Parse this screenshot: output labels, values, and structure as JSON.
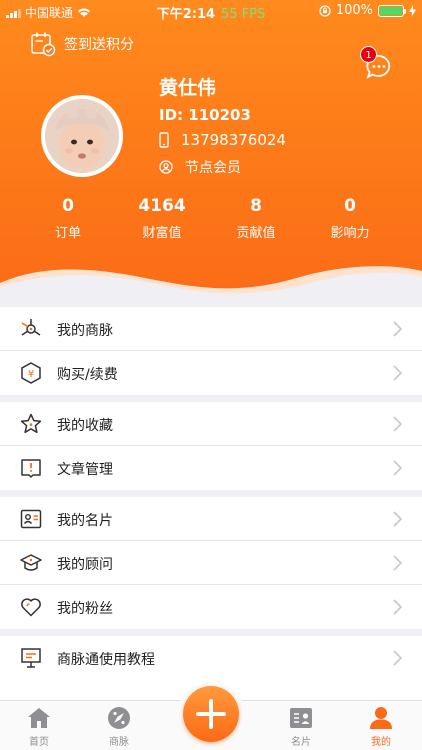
{
  "status_bar": {
    "carrier": "中国联通",
    "time": "下午2:14",
    "fps": "55 FPS",
    "battery": "100%"
  },
  "header": {
    "checkin_label": "签到送积分",
    "message_badge": "1",
    "user": {
      "name": "黄仕伟",
      "id": "ID:  110203",
      "phone": "13798376024",
      "level": "节点会员"
    },
    "stats": [
      {
        "value": "0",
        "label": "订单"
      },
      {
        "value": "4164",
        "label": "财富值"
      },
      {
        "value": "8",
        "label": "贡献值"
      },
      {
        "value": "0",
        "label": "影响力"
      }
    ]
  },
  "menu": {
    "group1": [
      {
        "label": "我的商脉",
        "icon": "network-icon"
      },
      {
        "label": "购买/续费",
        "icon": "yen-icon"
      }
    ],
    "group2": [
      {
        "label": "我的收藏",
        "icon": "star-icon"
      },
      {
        "label": "文章管理",
        "icon": "book-icon"
      }
    ],
    "group3": [
      {
        "label": "我的名片",
        "icon": "card-icon"
      },
      {
        "label": "我的顾问",
        "icon": "graduation-cap-icon"
      },
      {
        "label": "我的粉丝",
        "icon": "heart-icon"
      }
    ],
    "group4": [
      {
        "label": "商脉通使用教程",
        "icon": "presentation-icon"
      }
    ]
  },
  "tabbar": {
    "tabs": [
      {
        "label": "首页",
        "icon": "home-icon"
      },
      {
        "label": "商脉",
        "icon": "compass-icon"
      },
      {
        "label": "名片",
        "icon": "id-card-icon"
      },
      {
        "label": "我的",
        "icon": "user-icon"
      }
    ],
    "active": "我的"
  },
  "colors": {
    "accent": "#fb6a16",
    "header_top": "#ff8a1d",
    "badge": "#e60012"
  }
}
